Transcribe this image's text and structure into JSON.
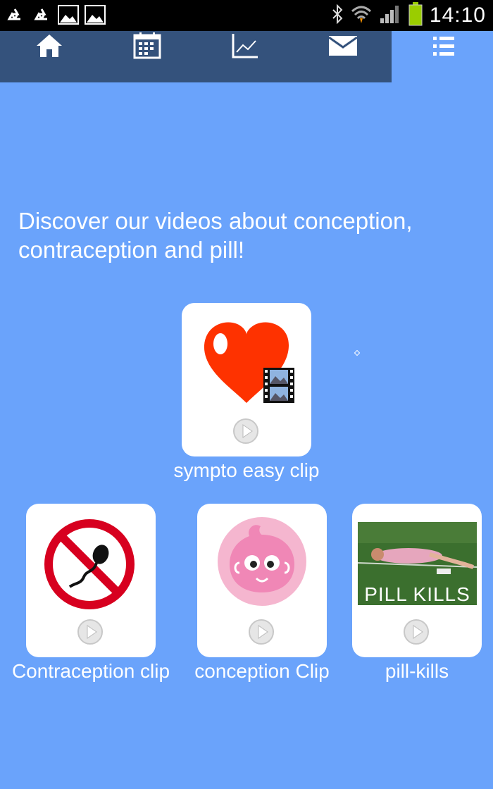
{
  "status_bar": {
    "time": "14:10",
    "icons": [
      "recycle-icon",
      "recycle-icon",
      "image-icon",
      "image-icon",
      "bluetooth-icon",
      "wifi-icon",
      "signal-icon",
      "battery-icon"
    ]
  },
  "nav": {
    "items": [
      {
        "icon": "home-icon"
      },
      {
        "icon": "calendar-icon"
      },
      {
        "icon": "chart-icon"
      },
      {
        "icon": "mail-icon"
      },
      {
        "icon": "list-icon"
      }
    ]
  },
  "main": {
    "heading": "Discover our videos about conception, contraception and pill!",
    "videos": [
      {
        "caption": "sympto easy clip",
        "thumb": "heart-film-icon"
      },
      {
        "caption": "Contraception clip",
        "thumb": "no-sperm-icon"
      },
      {
        "caption": "conception Clip",
        "thumb": "baby-face-icon"
      },
      {
        "caption": "pill-kills",
        "thumb": "photo-pill-kills",
        "thumb_text": "PILL KILLS"
      }
    ]
  },
  "colors": {
    "background": "#6aa3fb",
    "navbar": "#34527c",
    "heart": "#fe3200",
    "no_sign": "#d7001f",
    "baby": "#f087b6"
  }
}
